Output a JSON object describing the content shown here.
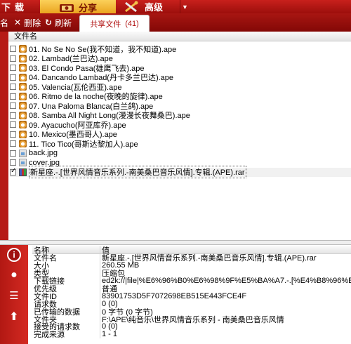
{
  "toolbar": {
    "download_label": "下载",
    "share_label": "分享",
    "advanced_label": "高级"
  },
  "secondary_toolbar": {
    "rename_label": "名",
    "delete_label": "删除",
    "refresh_label": "刷新",
    "tab_label": "共享文件",
    "tab_count": "(41)"
  },
  "file_list": {
    "column_header": "文件名",
    "files": [
      {
        "name": "01. No Se No Se(我不知道，我不知道).ape",
        "type": "audio",
        "checked": false
      },
      {
        "name": "02. Lambad(兰巴达).ape",
        "type": "audio",
        "checked": false
      },
      {
        "name": "03. El Condo Pasa(雄鹰飞去).ape",
        "type": "audio",
        "checked": false
      },
      {
        "name": "04. Dancando Lambad(丹卡多兰巴达).ape",
        "type": "audio",
        "checked": false
      },
      {
        "name": "05. Valencia(瓦伦西亚).ape",
        "type": "audio",
        "checked": false
      },
      {
        "name": "06. Ritmo de la noche(夜晚的旋律).ape",
        "type": "audio",
        "checked": false
      },
      {
        "name": "07. Una Paloma Blanca(白兰鸽).ape",
        "type": "audio",
        "checked": false
      },
      {
        "name": "08. Samba All Night Long(漫漫长夜舞桑巴).ape",
        "type": "audio",
        "checked": false
      },
      {
        "name": "09. Ayacucho(阿亚库乔).ape",
        "type": "audio",
        "checked": false
      },
      {
        "name": "10. Mexico(墨西哥人).ape",
        "type": "audio",
        "checked": false
      },
      {
        "name": "11. Tico Tico(哥斯达黎加人).ape",
        "type": "audio",
        "checked": false
      },
      {
        "name": "back.jpg",
        "type": "image",
        "checked": false
      },
      {
        "name": "cover.jpg",
        "type": "image",
        "checked": false
      },
      {
        "name": "新星座.-.[世界风情音乐系列.-南美桑巴音乐风情].专辑.(APE).rar",
        "type": "rar",
        "checked": true,
        "selected": true
      }
    ]
  },
  "details": {
    "header_key": "名称",
    "header_value": "值",
    "rows": [
      {
        "key": "文件名",
        "value": "新星座.-.[世界风情音乐系列.-南美桑巴音乐风情].专辑.(APE).rar"
      },
      {
        "key": "大小",
        "value": "260.55 MB"
      },
      {
        "key": "类型",
        "value": "压缩包"
      },
      {
        "key": "下载链接",
        "value": "ed2k://|file|%E6%96%B0%E6%98%9F%E5%BA%A7.-.[%E4%B8%96%E7%95%8C%E9"
      },
      {
        "key": "优先级",
        "value": "普通"
      },
      {
        "key": "文件ID",
        "value": "83901753D5F7072698EB515E443FCE4F"
      },
      {
        "key": "请求数",
        "value": "0 (0)"
      },
      {
        "key": "已传输的数据",
        "value": "0 字节 (0 字节)"
      },
      {
        "key": "文件夹",
        "value": "F:\\APE\\纯音乐\\世界风情音乐系列 - 南美桑巴音乐风情"
      },
      {
        "key": "接受的请求数",
        "value": "0 (0)"
      },
      {
        "key": "完成来源",
        "value": "1 - 1"
      }
    ]
  },
  "icons": {
    "share": "share-icon",
    "advanced": "tools-icon",
    "delete": "close-icon",
    "refresh": "refresh-icon"
  },
  "colors": {
    "toolbar_red": "#b61a16",
    "share_gold": "#f2b73a",
    "tab_text": "#b01010"
  }
}
